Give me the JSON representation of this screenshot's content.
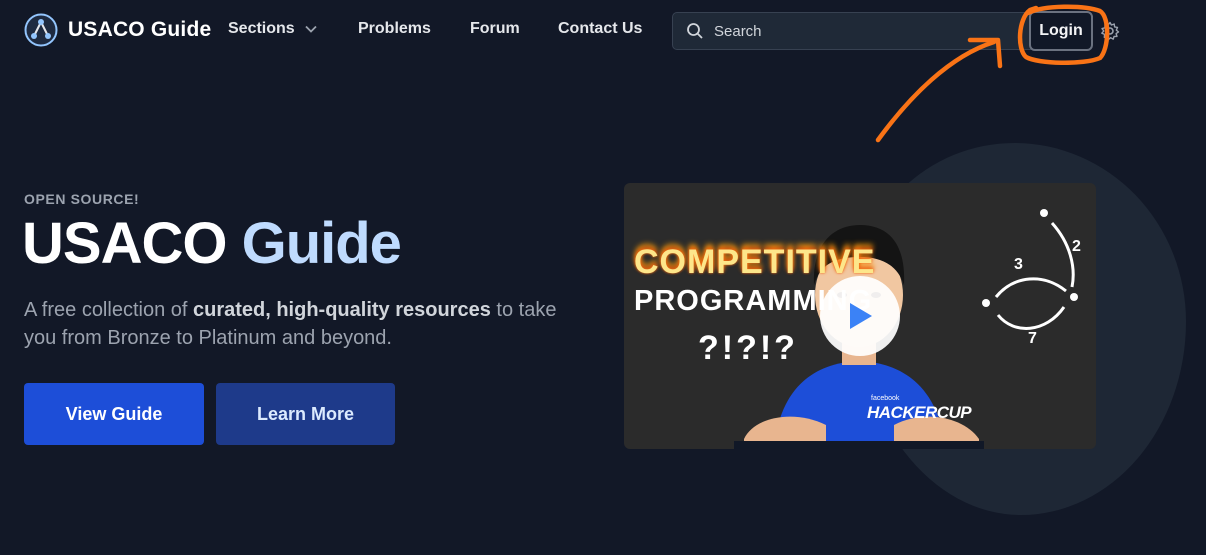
{
  "nav": {
    "brand": "USACO Guide",
    "links": {
      "sections": "Sections",
      "problems": "Problems",
      "forum": "Forum",
      "contact": "Contact Us"
    },
    "search_placeholder": "Search",
    "login_label": "Login"
  },
  "hero": {
    "eyebrow": "OPEN SOURCE!",
    "title_main": "USACO",
    "title_accent": "Guide",
    "desc_prefix": "A free collection of ",
    "desc_bold": "curated, high-quality resources",
    "desc_suffix": " to take you from Bronze to Platinum and beyond.",
    "primary_button": "View Guide",
    "secondary_button": "Learn More"
  },
  "video": {
    "line1": "COMPETITIVE",
    "line2": "PROGRAMMING",
    "line3": "?!?!?",
    "badge_small": "facebook",
    "badge": "HACKERCUP",
    "graph_labels": [
      "3",
      "2",
      "7"
    ]
  },
  "colors": {
    "background": "#121827",
    "accent": "#bfdbfe",
    "primary_button": "#1d4ed8",
    "secondary_button": "#1e3a8a",
    "annotation": "#f97316"
  }
}
